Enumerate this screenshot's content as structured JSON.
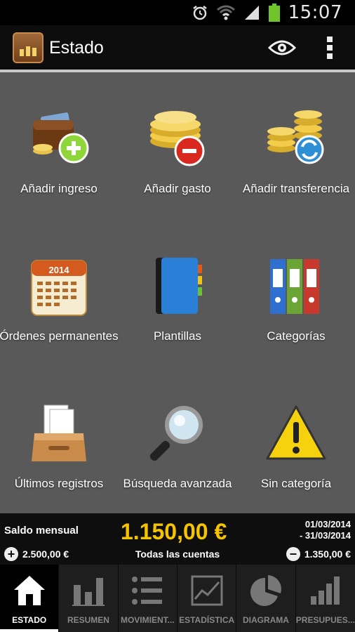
{
  "status_bar": {
    "time": "15:07",
    "icons": [
      "alarm-icon",
      "wifi-icon",
      "signal-icon",
      "battery-icon"
    ]
  },
  "action_bar": {
    "title": "Estado",
    "actions": [
      "eye-icon",
      "overflow-menu-icon"
    ]
  },
  "tiles": [
    {
      "label": "Añadir ingreso",
      "icon": "wallet-add-icon"
    },
    {
      "label": "Añadir gasto",
      "icon": "coins-remove-icon"
    },
    {
      "label": "Añadir transferencia",
      "icon": "coins-transfer-icon"
    },
    {
      "label": "Órdenes permanentes",
      "icon": "calendar-icon",
      "calendar_year": "2014"
    },
    {
      "label": "Plantillas",
      "icon": "notebook-icon"
    },
    {
      "label": "Categorías",
      "icon": "binders-icon"
    },
    {
      "label": "Últimos registros",
      "icon": "inbox-tray-icon"
    },
    {
      "label": "Búsqueda avanzada",
      "icon": "magnifier-icon"
    },
    {
      "label": "Sin categoría",
      "icon": "warning-icon"
    }
  ],
  "summary": {
    "label": "Saldo mensual",
    "amount": "1.150,00 €",
    "date_from": "01/03/2014",
    "date_to": "- 31/03/2014",
    "income": "2.500,00 €",
    "accounts": "Todas las cuentas",
    "expense": "1.350,00 €"
  },
  "tabs": [
    {
      "label": "ESTADO",
      "icon": "home-icon",
      "active": true
    },
    {
      "label": "RESUMEN",
      "icon": "bar-chart-icon",
      "active": false
    },
    {
      "label": "MOVIMIENT...",
      "icon": "list-icon",
      "active": false
    },
    {
      "label": "ESTADÍSTICA",
      "icon": "line-chart-icon",
      "active": false
    },
    {
      "label": "DIAGRAMA",
      "icon": "pie-chart-icon",
      "active": false
    },
    {
      "label": "PRESUPUES...",
      "icon": "budget-bars-icon",
      "active": false
    }
  ],
  "colors": {
    "accent_amount": "#f5c400",
    "grid_bg": "#595959",
    "bar_bg": "#0d0d0d"
  }
}
